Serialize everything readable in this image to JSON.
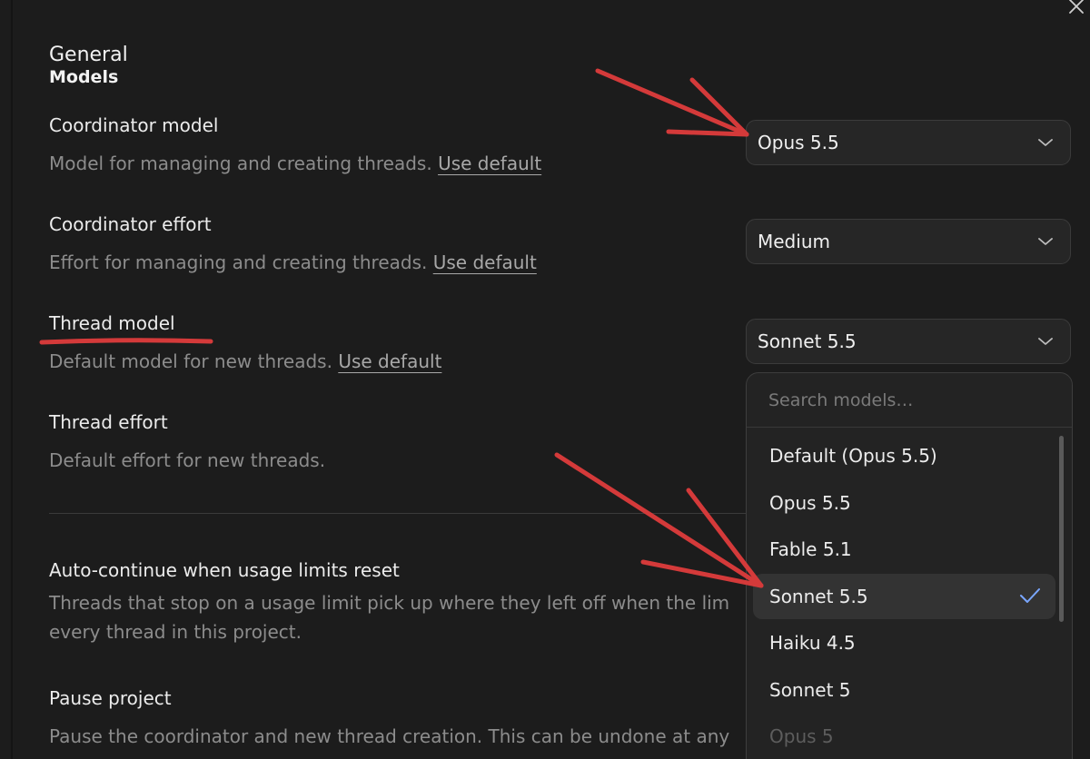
{
  "header": {
    "title": "General",
    "subtitle": "Models"
  },
  "settings": {
    "coordinator_model": {
      "title": "Coordinator model",
      "description": "Model for managing and creating threads.",
      "use_default": "Use default",
      "value": "Opus 5.5"
    },
    "coordinator_effort": {
      "title": "Coordinator effort",
      "description": "Effort for managing and creating threads.",
      "use_default": "Use default",
      "value": "Medium"
    },
    "thread_model": {
      "title": "Thread model",
      "description": "Default model for new threads.",
      "use_default": "Use default",
      "value": "Sonnet 5.5"
    },
    "thread_effort": {
      "title": "Thread effort",
      "description": "Default effort for new threads."
    },
    "auto_continue": {
      "title": "Auto-continue when usage limits reset",
      "description_line1": "Threads that stop on a usage limit pick up where they left off when the lim",
      "description_line2": "every thread in this project."
    },
    "pause_project": {
      "title": "Pause project",
      "description": "Pause the coordinator and new thread creation. This can be undone at any"
    }
  },
  "model_dropdown": {
    "search_placeholder": "Search models…",
    "options": [
      {
        "label": "Default (Opus 5.5)",
        "selected": false
      },
      {
        "label": "Opus 5.5",
        "selected": false
      },
      {
        "label": "Fable 5.1",
        "selected": false
      },
      {
        "label": "Sonnet 5.5",
        "selected": true
      },
      {
        "label": "Haiku 4.5",
        "selected": false
      },
      {
        "label": "Sonnet 5",
        "selected": false
      },
      {
        "label": "Opus 5",
        "selected": false
      }
    ]
  },
  "icons": {
    "close": "close-icon",
    "chevron": "chevron-down-icon",
    "check": "checkmark-icon"
  },
  "colors": {
    "background": "#1c1c1c",
    "annotation_red": "#d43a3a",
    "check_blue": "#7aa7ff"
  }
}
